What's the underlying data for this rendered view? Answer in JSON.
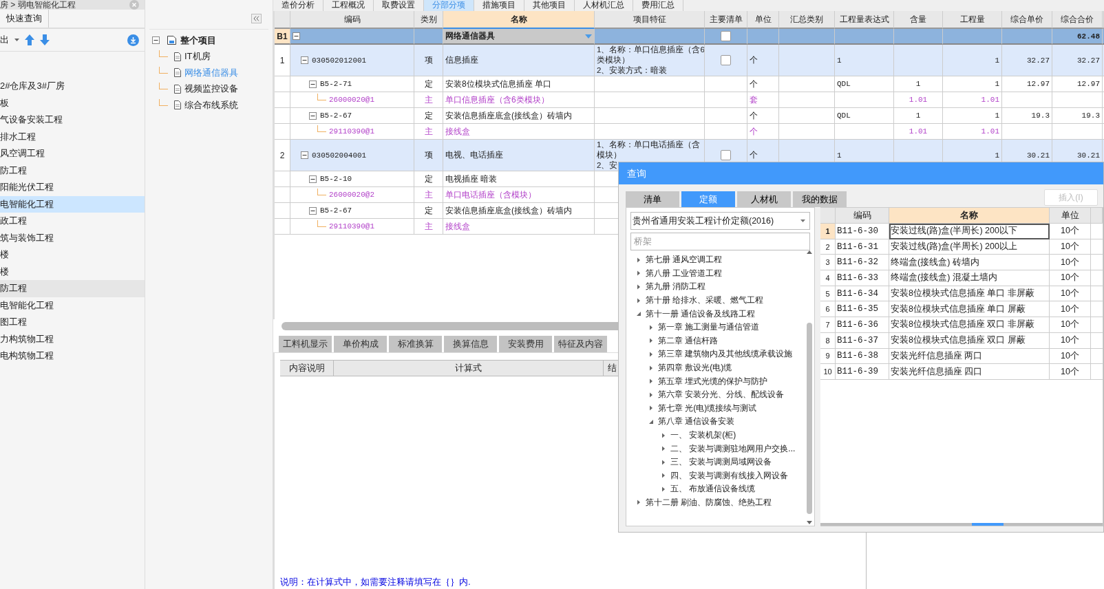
{
  "sidebar": {
    "breadcrumb": "房 > 弱电智能化工程",
    "tab": "快速查询",
    "export_label": "出",
    "items": [
      {
        "label": "2#仓库及3#厂房",
        "selected": false,
        "hovered": false
      },
      {
        "label": "板",
        "selected": false,
        "hovered": false
      },
      {
        "label": "气设备安装工程",
        "selected": false,
        "hovered": false
      },
      {
        "label": "排水工程",
        "selected": false,
        "hovered": false
      },
      {
        "label": "风空调工程",
        "selected": false,
        "hovered": false
      },
      {
        "label": "防工程",
        "selected": false,
        "hovered": false
      },
      {
        "label": "阳能光伏工程",
        "selected": false,
        "hovered": false
      },
      {
        "label": "电智能化工程",
        "selected": true,
        "hovered": false
      },
      {
        "label": "政工程",
        "selected": false,
        "hovered": false
      },
      {
        "label": "筑与装饰工程",
        "selected": false,
        "hovered": false
      },
      {
        "label": "楼",
        "selected": false,
        "hovered": false
      },
      {
        "label": "楼",
        "selected": false,
        "hovered": false
      },
      {
        "label": "防工程",
        "selected": false,
        "hovered": true
      },
      {
        "label": "电智能化工程",
        "selected": false,
        "hovered": false
      },
      {
        "label": "图工程",
        "selected": false,
        "hovered": false
      },
      {
        "label": "力构筑物工程",
        "selected": false,
        "hovered": false
      },
      {
        "label": "电构筑物工程",
        "selected": false,
        "hovered": false
      }
    ]
  },
  "tree_panel": {
    "root": {
      "label": "整个项目",
      "expanded": true,
      "children": [
        {
          "label": "IT机房",
          "selected": false
        },
        {
          "label": "网络通信器具",
          "selected": true
        },
        {
          "label": "视频监控设备",
          "selected": false
        },
        {
          "label": "综合布线系统",
          "selected": false
        }
      ]
    }
  },
  "top_tabs": [
    {
      "label": "造价分析",
      "selected": false
    },
    {
      "label": "工程概况",
      "selected": false
    },
    {
      "label": "取费设置",
      "selected": false
    },
    {
      "label": "分部分项",
      "selected": true
    },
    {
      "label": "措施项目",
      "selected": false
    },
    {
      "label": "其他项目",
      "selected": false
    },
    {
      "label": "人材机汇总",
      "selected": false
    },
    {
      "label": "费用汇总",
      "selected": false
    }
  ],
  "table": {
    "columns": [
      {
        "label": "编码",
        "selected": false
      },
      {
        "label": "类别",
        "selected": false
      },
      {
        "label": "名称",
        "selected": true
      },
      {
        "label": "项目特征",
        "selected": false
      },
      {
        "label": "主要清单",
        "selected": false
      },
      {
        "label": "单位",
        "selected": false
      },
      {
        "label": "汇总类别",
        "selected": false
      },
      {
        "label": "工程量表达式",
        "selected": false
      },
      {
        "label": "含量",
        "selected": false
      },
      {
        "label": "工程量",
        "selected": false
      },
      {
        "label": "综合单价",
        "selected": false
      },
      {
        "label": "综合合价",
        "selected": false
      }
    ],
    "rows": [
      {
        "kind": "section",
        "number": "B1",
        "name": "网络通信器具",
        "main_list": false,
        "total": "62.48",
        "selected": true
      },
      {
        "kind": "bill",
        "number": "1",
        "code": "030502012001",
        "type": "项",
        "name": "信息插座",
        "feature": [
          "1、名称：单口信息插座（含6",
          "类模块）",
          "2、安装方式：暗装"
        ],
        "main_list": false,
        "unit": "个",
        "expr": "1",
        "qty": "1",
        "unit_price": "32.27",
        "total": "32.27",
        "selected": false
      },
      {
        "kind": "quota",
        "code": "B5-2-71",
        "type": "定",
        "name": "安装8位模块式信息插座 单口",
        "unit": "个",
        "expr": "QDL",
        "content": "1",
        "qty": "1",
        "unit_price": "12.97",
        "total": "12.97",
        "selected": false
      },
      {
        "kind": "material",
        "code": "26000020@1",
        "type": "主",
        "name": "单口信息插座（含6类模块）",
        "unit": "套",
        "content": "1.01",
        "qty": "1.01",
        "selected": false
      },
      {
        "kind": "quota",
        "code": "B5-2-67",
        "type": "定",
        "name": "安装信息插座底盒(接线盒）砖墙内",
        "unit": "个",
        "expr": "QDL",
        "content": "1",
        "qty": "1",
        "unit_price": "19.3",
        "total": "19.3",
        "selected": false
      },
      {
        "kind": "material",
        "code": "29110390@1",
        "type": "主",
        "name": "接线盒",
        "unit": "个",
        "content": "1.01",
        "qty": "1.01",
        "selected": false
      },
      {
        "kind": "bill",
        "number": "2",
        "code": "030502004001",
        "type": "项",
        "name": "电视、电话插座",
        "feature": [
          "1、名称：单口电话插座（含",
          "模块）",
          "2、安"
        ],
        "main_list": false,
        "unit": "个",
        "expr": "1",
        "qty": "1",
        "unit_price": "30.21",
        "total": "30.21",
        "selected": false
      },
      {
        "kind": "quota",
        "code": "B5-2-10",
        "type": "定",
        "name": "电视插座 暗装",
        "selected": false
      },
      {
        "kind": "material",
        "code": "26000020@2",
        "type": "主",
        "name": "单口电话插座（含模块）",
        "selected": false
      },
      {
        "kind": "quota",
        "code": "B5-2-67",
        "type": "定",
        "name": "安装信息插座底盒(接线盒）砖墙内",
        "selected": false
      },
      {
        "kind": "material",
        "code": "29110390@1",
        "type": "主",
        "name": "接线盒",
        "selected": false
      }
    ]
  },
  "bottom_panel": {
    "tabs": [
      "工料机显示",
      "单价构成",
      "标准换算",
      "换算信息",
      "安装费用",
      "特征及内容"
    ],
    "columns": [
      "内容说明",
      "计算式",
      "结"
    ],
    "note": "说明：在计算式中，如需要注释请填写在｛｝内."
  },
  "dialog": {
    "title": "查询",
    "tabs": [
      {
        "label": "清单",
        "selected": false
      },
      {
        "label": "定额",
        "selected": true
      },
      {
        "label": "人材机",
        "selected": false
      },
      {
        "label": "我的数据",
        "selected": false
      }
    ],
    "insert_button": {
      "label": "插入(I)",
      "disabled": true
    },
    "library": "贵州省通用安装工程计价定额(2016)",
    "search_placeholder": "桥架",
    "tree": [
      {
        "label": "第七册 通风空调工程",
        "expanded": false
      },
      {
        "label": "第八册 工业管道工程",
        "expanded": false
      },
      {
        "label": "第九册 消防工程",
        "expanded": false
      },
      {
        "label": "第十册 给排水、采暖、燃气工程",
        "expanded": false
      },
      {
        "label": "第十一册 通信设备及线路工程",
        "expanded": true,
        "children": [
          {
            "label": "第一章 施工测量与通信管道",
            "expanded": false
          },
          {
            "label": "第二章 通信杆路",
            "expanded": false
          },
          {
            "label": "第三章 建筑物内及其他线缆承载设施",
            "expanded": false
          },
          {
            "label": "第四章 敷设光(电)缆",
            "expanded": false
          },
          {
            "label": "第五章 埋式光缆的保护与防护",
            "expanded": false
          },
          {
            "label": "第六章 安装分光、分线、配线设备",
            "expanded": false
          },
          {
            "label": "第七章 光(电)缆接续与测试",
            "expanded": false
          },
          {
            "label": "第八章 通信设备安装",
            "expanded": true,
            "children": [
              {
                "label": "一、 安装机架(柜)",
                "expanded": false
              },
              {
                "label": "二、 安装与调测驻地网用户交换...",
                "expanded": false
              },
              {
                "label": "三、 安装与调测局域网设备",
                "expanded": false
              },
              {
                "label": "四、 安装与调测有线接入网设备",
                "expanded": false
              },
              {
                "label": "五、 布放通信设备线缆",
                "expanded": false
              }
            ]
          }
        ]
      },
      {
        "label": "第十二册 刷油、防腐蚀、绝热工程",
        "expanded": false
      }
    ],
    "grid": {
      "columns": [
        {
          "label": "编码",
          "selected": false
        },
        {
          "label": "名称",
          "selected": true
        },
        {
          "label": "单位",
          "selected": false
        }
      ],
      "rows": [
        {
          "index": "1",
          "code": "B11-6-30",
          "name": "安装过线(路)盒(半周长) 200以下",
          "unit": "10个",
          "selected": true
        },
        {
          "index": "2",
          "code": "B11-6-31",
          "name": "安装过线(路)盒(半周长) 200以上",
          "unit": "10个",
          "selected": false
        },
        {
          "index": "3",
          "code": "B11-6-32",
          "name": "终端盒(接线盒) 砖墙内",
          "unit": "10个",
          "selected": false
        },
        {
          "index": "4",
          "code": "B11-6-33",
          "name": "终端盒(接线盒) 混凝土墙内",
          "unit": "10个",
          "selected": false
        },
        {
          "index": "5",
          "code": "B11-6-34",
          "name": "安装8位模块式信息插座 单口 非屏蔽",
          "unit": "10个",
          "selected": false
        },
        {
          "index": "6",
          "code": "B11-6-35",
          "name": "安装8位模块式信息插座 单口 屏蔽",
          "unit": "10个",
          "selected": false
        },
        {
          "index": "7",
          "code": "B11-6-36",
          "name": "安装8位模块式信息插座 双口 非屏蔽",
          "unit": "10个",
          "selected": false
        },
        {
          "index": "8",
          "code": "B11-6-37",
          "name": "安装8位模块式信息插座 双口 屏蔽",
          "unit": "10个",
          "selected": false
        },
        {
          "index": "9",
          "code": "B11-6-38",
          "name": "安装光纤信息插座 两口",
          "unit": "10个",
          "selected": false
        },
        {
          "index": "10",
          "code": "B11-6-39",
          "name": "安装光纤信息插座 四口",
          "unit": "10个",
          "selected": false
        }
      ]
    }
  }
}
